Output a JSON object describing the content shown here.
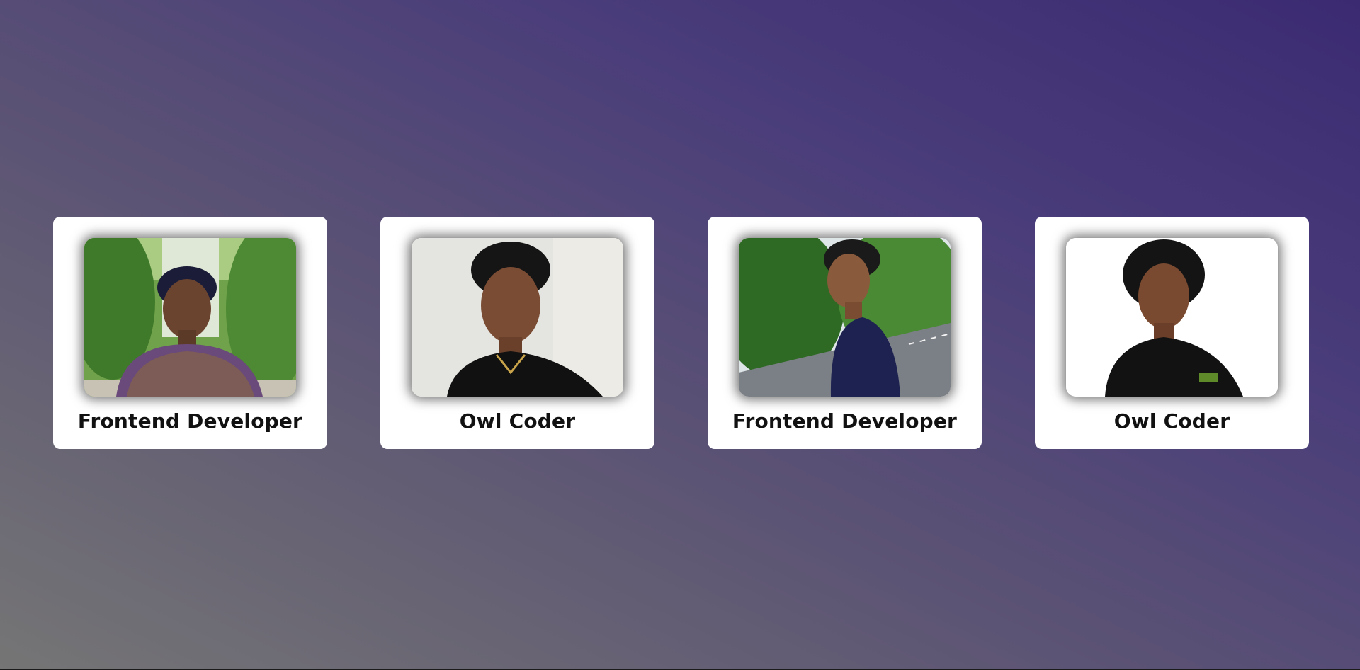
{
  "cards": [
    {
      "title": "Frontend Developer",
      "photo": "person-in-checked-shirt-outdoors"
    },
    {
      "title": "Owl Coder",
      "photo": "person-in-black-polo-studio"
    },
    {
      "title": "Frontend Developer",
      "photo": "person-on-road-with-trees"
    },
    {
      "title": "Owl Coder",
      "photo": "person-smiling-black-polo"
    }
  ]
}
